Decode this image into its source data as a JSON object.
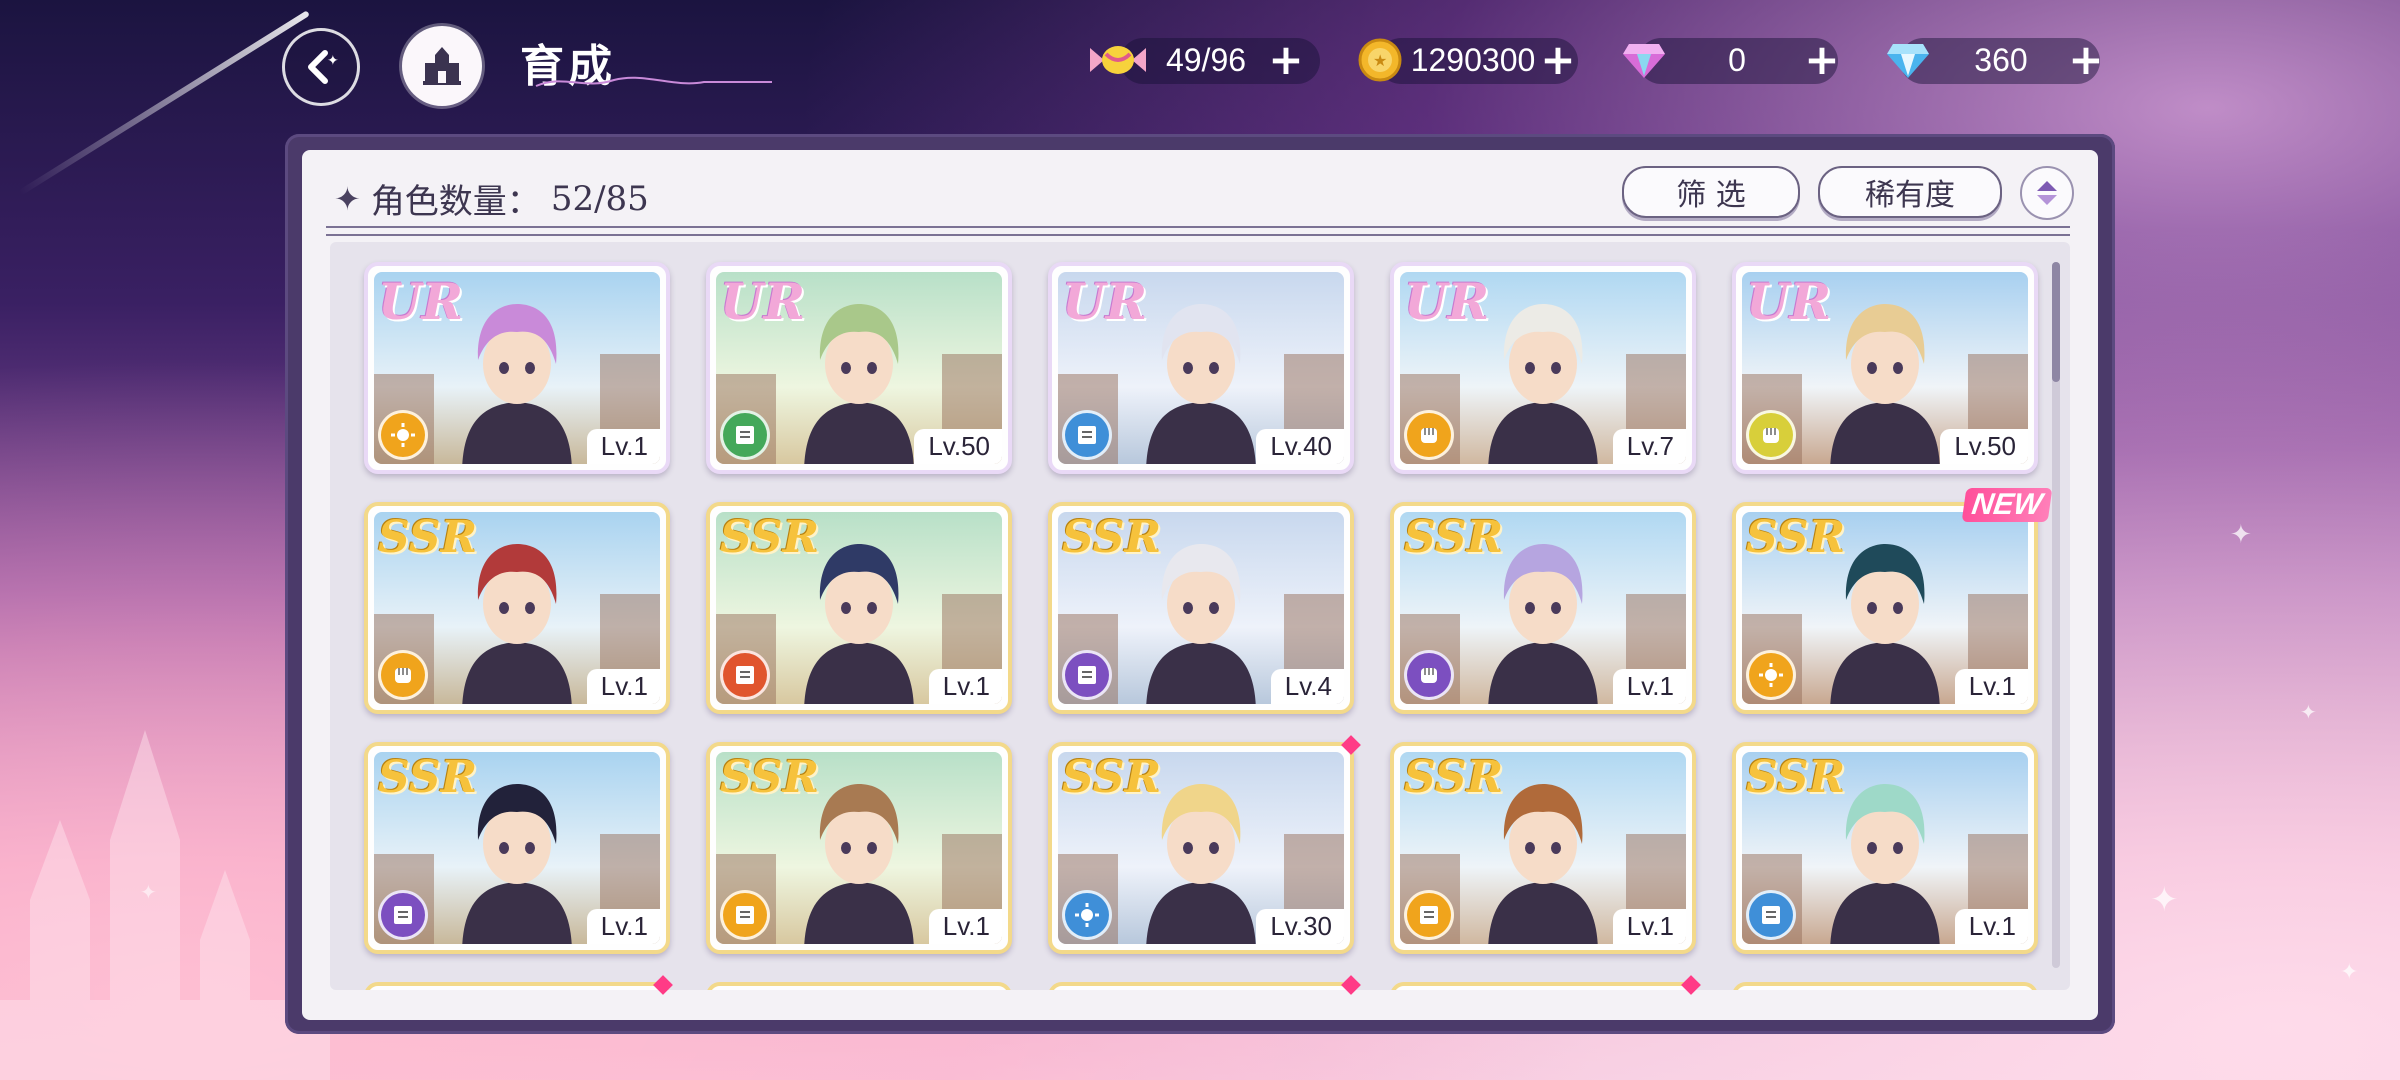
{
  "header": {
    "title": "育成",
    "resources": [
      {
        "name": "candy",
        "value": "49/96",
        "icon": "candy-icon"
      },
      {
        "name": "gold",
        "value": "1290300",
        "icon": "gold-coin-icon"
      },
      {
        "name": "pink-gem",
        "value": "0",
        "icon": "pink-gem-icon"
      },
      {
        "name": "blue-gem",
        "value": "360",
        "icon": "blue-gem-icon"
      }
    ],
    "plus": "+"
  },
  "panel": {
    "count_label": "角色数量：",
    "count_value": "52/85",
    "filter_label": "筛 选",
    "rarity_label": "稀有度"
  },
  "cards": [
    {
      "rarity": "UR",
      "level": "Lv.1",
      "hair": "#c98ad9",
      "type": "sun",
      "type_color": "#f0a41c",
      "new": false
    },
    {
      "rarity": "UR",
      "level": "Lv.50",
      "hair": "#a9c88a",
      "type": "book",
      "type_color": "#44a85a",
      "new": false
    },
    {
      "rarity": "UR",
      "level": "Lv.40",
      "hair": "#e1e4f0",
      "type": "book",
      "type_color": "#3f8fd8",
      "new": false
    },
    {
      "rarity": "UR",
      "level": "Lv.7",
      "hair": "#ecebe6",
      "type": "fist",
      "type_color": "#f0a41c",
      "new": false
    },
    {
      "rarity": "UR",
      "level": "Lv.50",
      "hair": "#e8cc94",
      "type": "fist",
      "type_color": "#d8cf3a",
      "new": false
    },
    {
      "rarity": "SSR",
      "level": "Lv.1",
      "hair": "#b23a3a",
      "type": "fist",
      "type_color": "#f0a41c",
      "new": false
    },
    {
      "rarity": "SSR",
      "level": "Lv.1",
      "hair": "#2f3a66",
      "type": "book",
      "type_color": "#e0552e",
      "new": false
    },
    {
      "rarity": "SSR",
      "level": "Lv.4",
      "hair": "#e8e8ee",
      "type": "book",
      "type_color": "#7c4fc0",
      "new": false
    },
    {
      "rarity": "SSR",
      "level": "Lv.1",
      "hair": "#b6a5e0",
      "type": "fist",
      "type_color": "#7c4fc0",
      "new": false
    },
    {
      "rarity": "SSR",
      "level": "Lv.1",
      "hair": "#1f4a5a",
      "type": "sun",
      "type_color": "#f0a41c",
      "new": true
    },
    {
      "rarity": "SSR",
      "level": "Lv.1",
      "hair": "#22223a",
      "type": "book",
      "type_color": "#7c4fc0",
      "new": false
    },
    {
      "rarity": "SSR",
      "level": "Lv.1",
      "hair": "#a87a52",
      "type": "book",
      "type_color": "#f0a41c",
      "new": false
    },
    {
      "rarity": "SSR",
      "level": "Lv.30",
      "hair": "#f0d58a",
      "type": "sun",
      "type_color": "#3f8fd8",
      "new": false
    },
    {
      "rarity": "SSR",
      "level": "Lv.1",
      "hair": "#b06a3a",
      "type": "book",
      "type_color": "#f0a41c",
      "new": false
    },
    {
      "rarity": "SSR",
      "level": "Lv.1",
      "hair": "#9ed9c8",
      "type": "book",
      "type_color": "#3f8fd8",
      "new": false
    }
  ],
  "new_badge": "NEW"
}
